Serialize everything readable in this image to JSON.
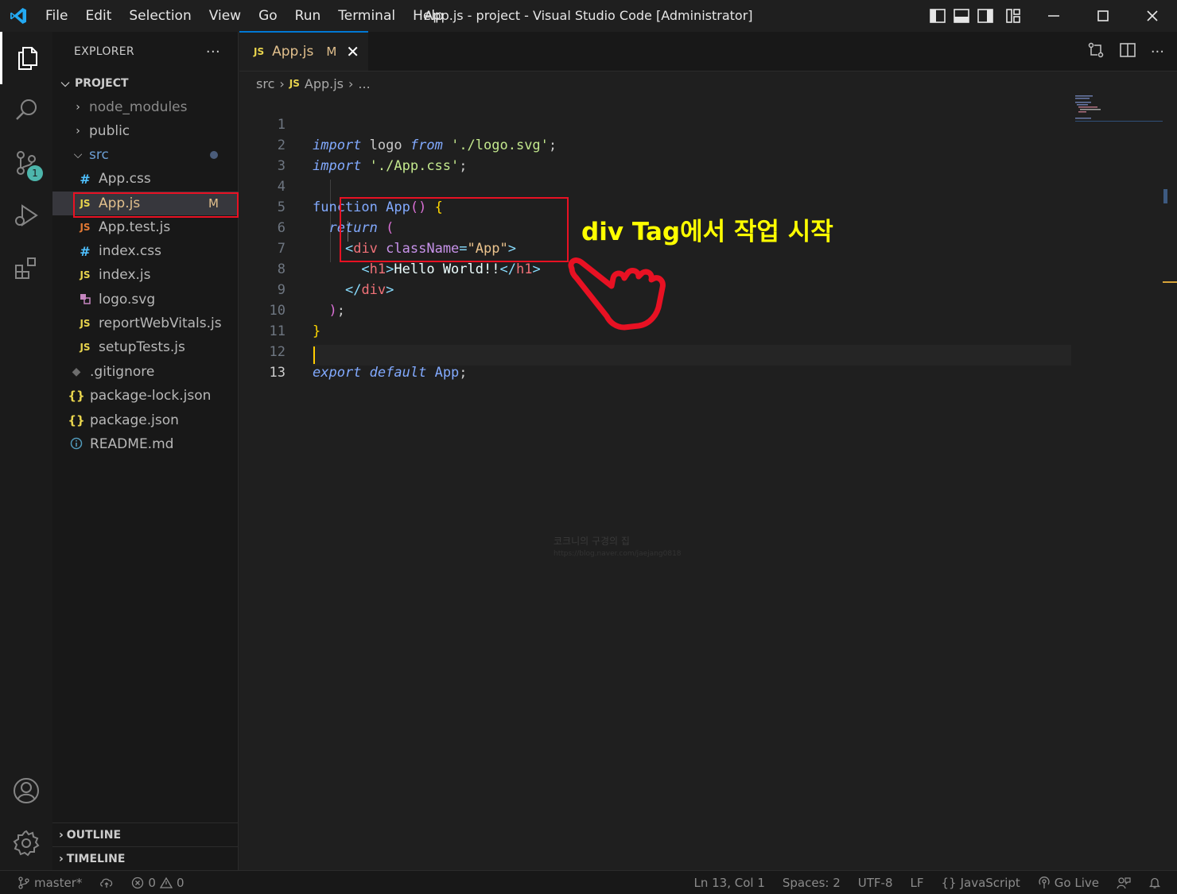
{
  "window": {
    "title": "App.js - project - Visual Studio Code [Administrator]",
    "menu": [
      "File",
      "Edit",
      "Selection",
      "View",
      "Go",
      "Run",
      "Terminal",
      "Help"
    ]
  },
  "activity": {
    "scm_badge": "1"
  },
  "sidebar": {
    "header": "EXPLORER",
    "more": "···",
    "project": "PROJECT",
    "items": [
      {
        "label": "node_modules",
        "type": "folder"
      },
      {
        "label": "public",
        "type": "folder"
      },
      {
        "label": "src",
        "type": "folder-open"
      },
      {
        "label": "App.css",
        "type": "css"
      },
      {
        "label": "App.js",
        "type": "js",
        "badge": "M"
      },
      {
        "label": "App.test.js",
        "type": "js"
      },
      {
        "label": "index.css",
        "type": "css"
      },
      {
        "label": "index.js",
        "type": "js"
      },
      {
        "label": "logo.svg",
        "type": "svg"
      },
      {
        "label": "reportWebVitals.js",
        "type": "js"
      },
      {
        "label": "setupTests.js",
        "type": "js"
      },
      {
        "label": ".gitignore",
        "type": "git"
      },
      {
        "label": "package-lock.json",
        "type": "json"
      },
      {
        "label": "package.json",
        "type": "json"
      },
      {
        "label": "README.md",
        "type": "info"
      }
    ],
    "outline": "OUTLINE",
    "timeline": "TIMELINE"
  },
  "tab": {
    "icon": "JS",
    "label": "App.js",
    "modified": "M"
  },
  "breadcrumb": {
    "folder": "src",
    "icon": "JS",
    "file": "App.js",
    "more": "..."
  },
  "code": {
    "line_numbers": [
      "1",
      "2",
      "3",
      "4",
      "5",
      "6",
      "7",
      "8",
      "9",
      "10",
      "11",
      "12",
      "13"
    ],
    "import1": {
      "kw": "import",
      "name": "logo",
      "from": "from",
      "path": "'./logo.svg'",
      "end": ";"
    },
    "import2": {
      "kw": "import",
      "path": "'./App.css'",
      "end": ";"
    },
    "func": {
      "kw": "function",
      "name": "App",
      "parens": "()",
      "brace": "{"
    },
    "ret": {
      "kw": "return",
      "paren": "("
    },
    "div_open": {
      "lt": "<",
      "tag": "div",
      "attr": "className",
      "eq": "=",
      "val": "\"App\"",
      "gt": ">"
    },
    "h1": {
      "open_lt": "<",
      "open_tag": "h1",
      "open_gt": ">",
      "text": "Hello World!!",
      "close_lt": "</",
      "close_tag": "h1",
      "close_gt": ">"
    },
    "div_close": {
      "lt": "</",
      "tag": "div",
      "gt": ">"
    },
    "ret_end": {
      "paren": ")",
      "semi": ";"
    },
    "func_end": "}",
    "export": {
      "kw": "export",
      "kw2": "default",
      "name": "App",
      "end": ";"
    }
  },
  "annotation": {
    "text": "div Tag에서 작업 시작"
  },
  "watermark": {
    "line1": "코크니의 구경의 집",
    "line2": "https://blog.naver.com/jaejang0818"
  },
  "status": {
    "branch": "master*",
    "errors": "0",
    "warnings": "0",
    "position": "Ln 13, Col 1",
    "spaces": "Spaces: 2",
    "encoding": "UTF-8",
    "eol": "LF",
    "language": "JavaScript",
    "golive": "Go Live"
  },
  "colors": {
    "accent": "#0078d4",
    "highlight": "#e81123",
    "annotation": "#ffff00",
    "modified": "#e2c08d"
  }
}
